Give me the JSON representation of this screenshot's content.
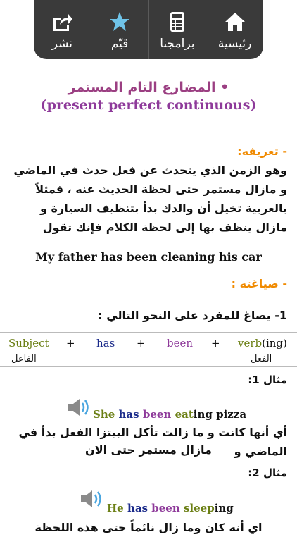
{
  "toolbar": {
    "items": [
      {
        "label": "نشر",
        "icon": "share-icon"
      },
      {
        "label": "قيّم",
        "icon": "star-icon"
      },
      {
        "label": "برامجنا",
        "icon": "apps-icon"
      },
      {
        "label": "رئيسية",
        "icon": "home-icon"
      }
    ]
  },
  "title": {
    "arabic": "• المضارع التام المستمر",
    "english": "(present perfect continuous)"
  },
  "definition": {
    "heading": "- تعريفه:",
    "text": "وهو الزمن الذي يتحدث عن فعل حدث في الماضي و مازال مستمر حتى لحظة الحديث عنه ، فمثلاً بالعربية تخيل أن والدك بدأ بتنظيف السيارة و مازال ينظف بها إلى لحظة الكلام فإنك تقول"
  },
  "example_main": "My father has been cleaning his car",
  "formation": {
    "heading": "- صياغته :",
    "rule": "1- يصاغ للمفرد على النحو التالي :",
    "formula": {
      "subject": "Subject",
      "plus1": "+",
      "has": "has",
      "plus2": "+",
      "been": "been",
      "plus3": "+",
      "verb": "verb",
      "ing": "(ing)"
    },
    "subject_ar": "الفاعل",
    "verb_ar": "الفعل"
  },
  "examples": [
    {
      "label": "مثال 1:",
      "sentence": {
        "subject": "She",
        "has": "has",
        "been": "been",
        "verb": "eat",
        "ing": "ing",
        "rest": "pizza"
      },
      "translation_line1": "أي أنها كانت و ما زالت تأكل البيتزا الفعل بدأ في الماضي و",
      "translation_line2": "مازال مستمر حتى الان"
    },
    {
      "label": "مثال 2:",
      "sentence": {
        "subject": "He",
        "has": "has",
        "been": "been",
        "verb": "sleep",
        "ing": "ing",
        "rest": ""
      },
      "translation_line1": "اي أنه كان وما زال نائماً حتى هذه اللحظة"
    }
  ],
  "colors": {
    "toolbar_bg": "#3a3a3a",
    "active_icon": "#6fc3e8",
    "title_purple": "#9b3f82",
    "heading_orange": "#f08a00",
    "subject_green": "#7a9a12",
    "has_navy": "#1a2a8a",
    "been_purple": "#8e3a9a"
  }
}
